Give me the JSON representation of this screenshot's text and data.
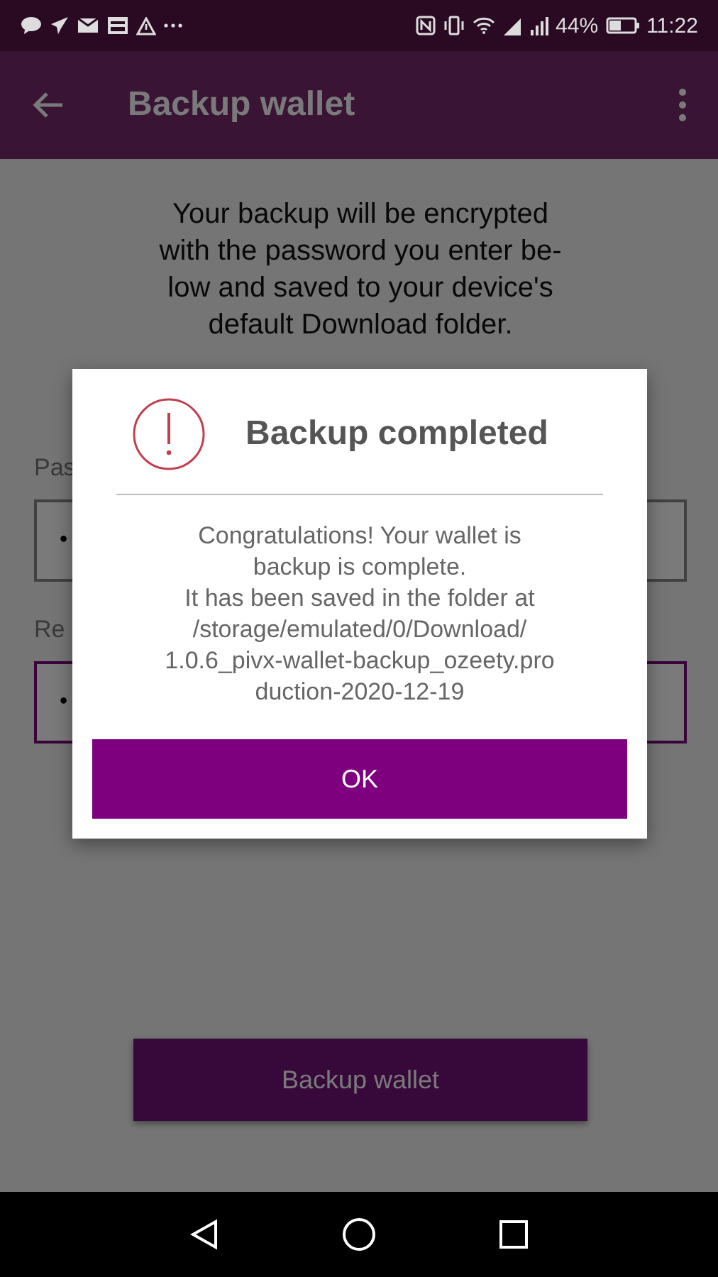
{
  "status_bar": {
    "battery": "44%",
    "time": "11:22"
  },
  "app_bar": {
    "title": "Backup wallet"
  },
  "intro": "Your backup will be encrypted\nwith the password you enter be-\nlow and saved to your device's\ndefault Download folder.",
  "fields": [
    {
      "label": "Pas",
      "value": "•",
      "focused": false
    },
    {
      "label": "Re",
      "value": "•",
      "focused": true
    }
  ],
  "primary_button": "Backup wallet",
  "dialog": {
    "title": "Backup completed",
    "message": "Congratulations! Your wallet is\nbackup is complete.\nIt has been saved in the folder at\n/storage/emulated/0/Download/\n1.0.6_pivx-wallet-backup_ozeety.pro\nduction-2020-12-19",
    "button": "OK"
  }
}
